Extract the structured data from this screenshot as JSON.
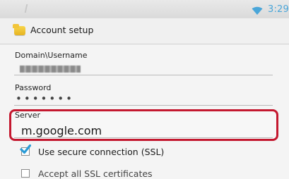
{
  "status_bar": {
    "time": "3:29",
    "time_color": "#4aa6d9",
    "signal_icon": "wifi-icon"
  },
  "action_bar": {
    "title": "Account setup",
    "icon": "email-app-icon"
  },
  "form": {
    "domain_username": {
      "label": "Domain\\Username",
      "value_obscured": true
    },
    "password": {
      "label": "Password",
      "value": "•••••••"
    },
    "server": {
      "label": "Server",
      "value": "m.google.com",
      "highlight_color": "#c4182f"
    },
    "use_ssl": {
      "label": "Use secure connection (SSL)",
      "checked": true
    },
    "accept_all_ssl": {
      "label": "Accept all SSL certificates",
      "checked": false
    }
  }
}
